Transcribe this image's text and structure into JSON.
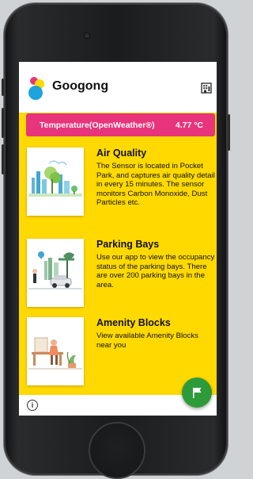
{
  "app": {
    "title": "Googong"
  },
  "temperature": {
    "label": "Temperature(OpenWeather®)",
    "value": "4.77 °C"
  },
  "cards": [
    {
      "title": "Air Quality",
      "body": "The Sensor is located in Pocket Park, and captures air quality detail in every 15 minutes. The sensor monitors Carbon Monoxide, Dust Particles etc.",
      "icon": "city-air-illustration"
    },
    {
      "title": "Parking Bays",
      "body": "Use our app to view the occupancy status of the parking bays. There are over 200 parking bays in the area.",
      "icon": "parking-illustration"
    },
    {
      "title": "Amenity Blocks",
      "body": "View available Amenity Blocks near you",
      "icon": "amenity-illustration"
    }
  ],
  "icons": {
    "header": "building-icon",
    "fab": "flag-icon",
    "bottom": "info-icon"
  },
  "colors": {
    "background": "#ffd900",
    "temperature_bar": "#e8347a",
    "fab": "#2e9b3a",
    "header": "#ffffff"
  }
}
